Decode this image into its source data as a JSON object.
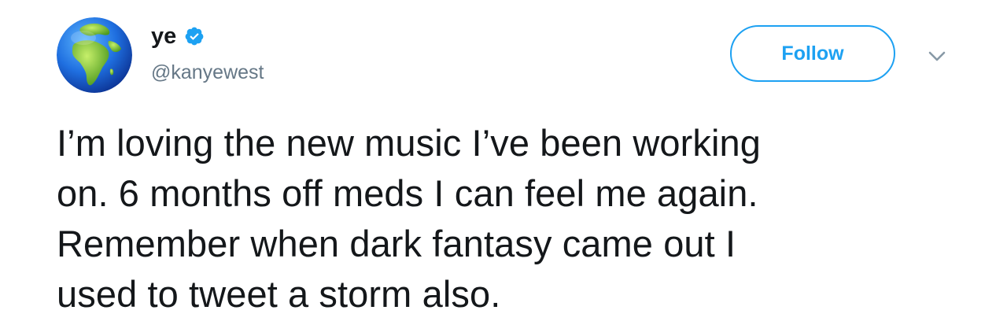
{
  "author": {
    "display_name": "ye",
    "handle": "@kanyewest",
    "verified": true,
    "avatar_icon": "globe-africa-europe-icon"
  },
  "actions": {
    "follow_label": "Follow",
    "menu_icon": "chevron-down-icon"
  },
  "tweet": {
    "lines": [
      "I’m loving the new music I’ve been working",
      "on. 6 months off meds I can feel me again.",
      "Remember when dark fantasy came out I",
      "used to tweet a storm also."
    ]
  },
  "colors": {
    "accent": "#1da1f2",
    "text": "#14171a",
    "secondary_text": "#657786"
  }
}
